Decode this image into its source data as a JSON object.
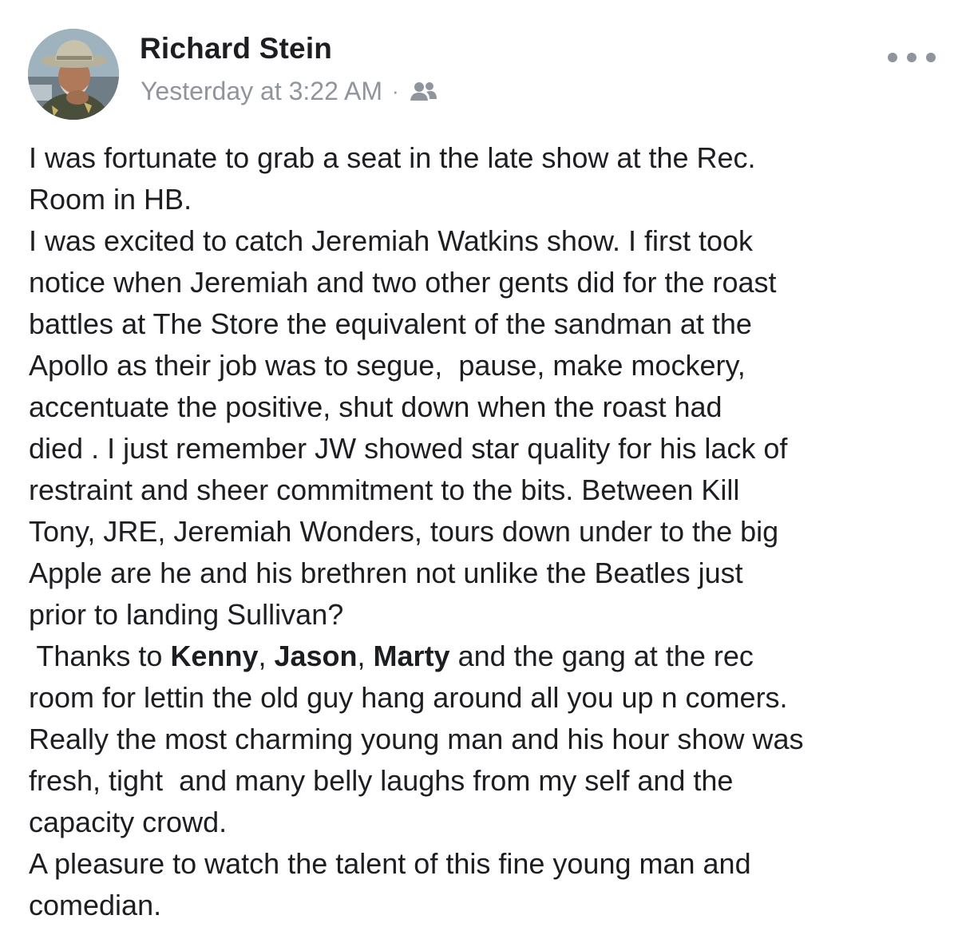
{
  "post": {
    "author": "Richard Stein",
    "timestamp": "Yesterday at 3:22 AM",
    "separator": "·",
    "audience_icon": "friends-icon",
    "more_icon": "more-options-icon",
    "body_lines": [
      "I was fortunate to grab a seat in the late show at the Rec.",
      "Room in HB.",
      "I was excited to catch Jeremiah Watkins show. I first took",
      "notice when Jeremiah and two other gents did for the roast",
      "battles at The Store the equivalent of the sandman at the",
      "Apollo as their job was to segue,  pause, make mockery,",
      "accentuate the positive, shut down when the roast had",
      "died . I just remember JW showed star quality for his lack of",
      "restraint and sheer commitment to the bits. Between Kill",
      "Tony, JRE, Jeremiah Wonders, tours down under to the big",
      "Apple are he and his brethren not unlike the Beatles just",
      "prior to landing Sullivan?"
    ],
    "thanks_line": {
      "prefix": " Thanks to ",
      "mention_1": "Kenny",
      "sep_1": ", ",
      "mention_2": "Jason",
      "sep_2": ", ",
      "mention_3": "Marty",
      "suffix": " and the gang at the rec"
    },
    "body_lines_after": [
      "room for lettin the old guy hang around all you up n comers.",
      "Really the most charming young man and his hour show was",
      "fresh, tight  and many belly laughs from my self and the",
      "capacity crowd.",
      "A pleasure to watch the talent of this fine young man and",
      "comedian."
    ]
  }
}
